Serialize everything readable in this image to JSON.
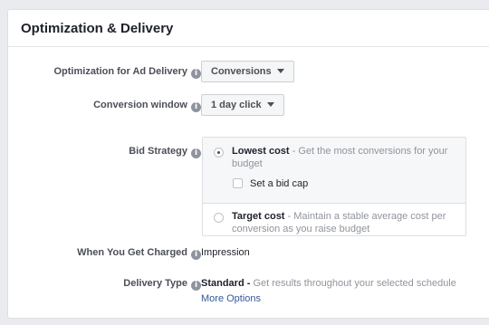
{
  "panel": {
    "title": "Optimization & Delivery"
  },
  "optimization": {
    "label": "Optimization for Ad Delivery",
    "value": "Conversions"
  },
  "conversion_window": {
    "label": "Conversion window",
    "value": "1 day click"
  },
  "bid_strategy": {
    "label": "Bid Strategy",
    "options": [
      {
        "title": "Lowest cost",
        "description": " - Get the most conversions for your budget",
        "selected": true
      },
      {
        "title": "Target cost",
        "description": " - Maintain a stable average cost per conversion as you raise budget",
        "selected": false
      }
    ],
    "bid_cap_label": "Set a bid cap",
    "bid_cap_checked": false
  },
  "charged": {
    "label": "When You Get Charged",
    "value": "Impression"
  },
  "delivery_type": {
    "label": "Delivery Type",
    "value_bold": "Standard -",
    "value_rest": " Get results throughout your selected schedule",
    "more_options": "More Options"
  },
  "icons": {
    "info": "info-icon",
    "caret": "caret-down-icon",
    "radio": "radio-button",
    "checkbox": "checkbox"
  }
}
